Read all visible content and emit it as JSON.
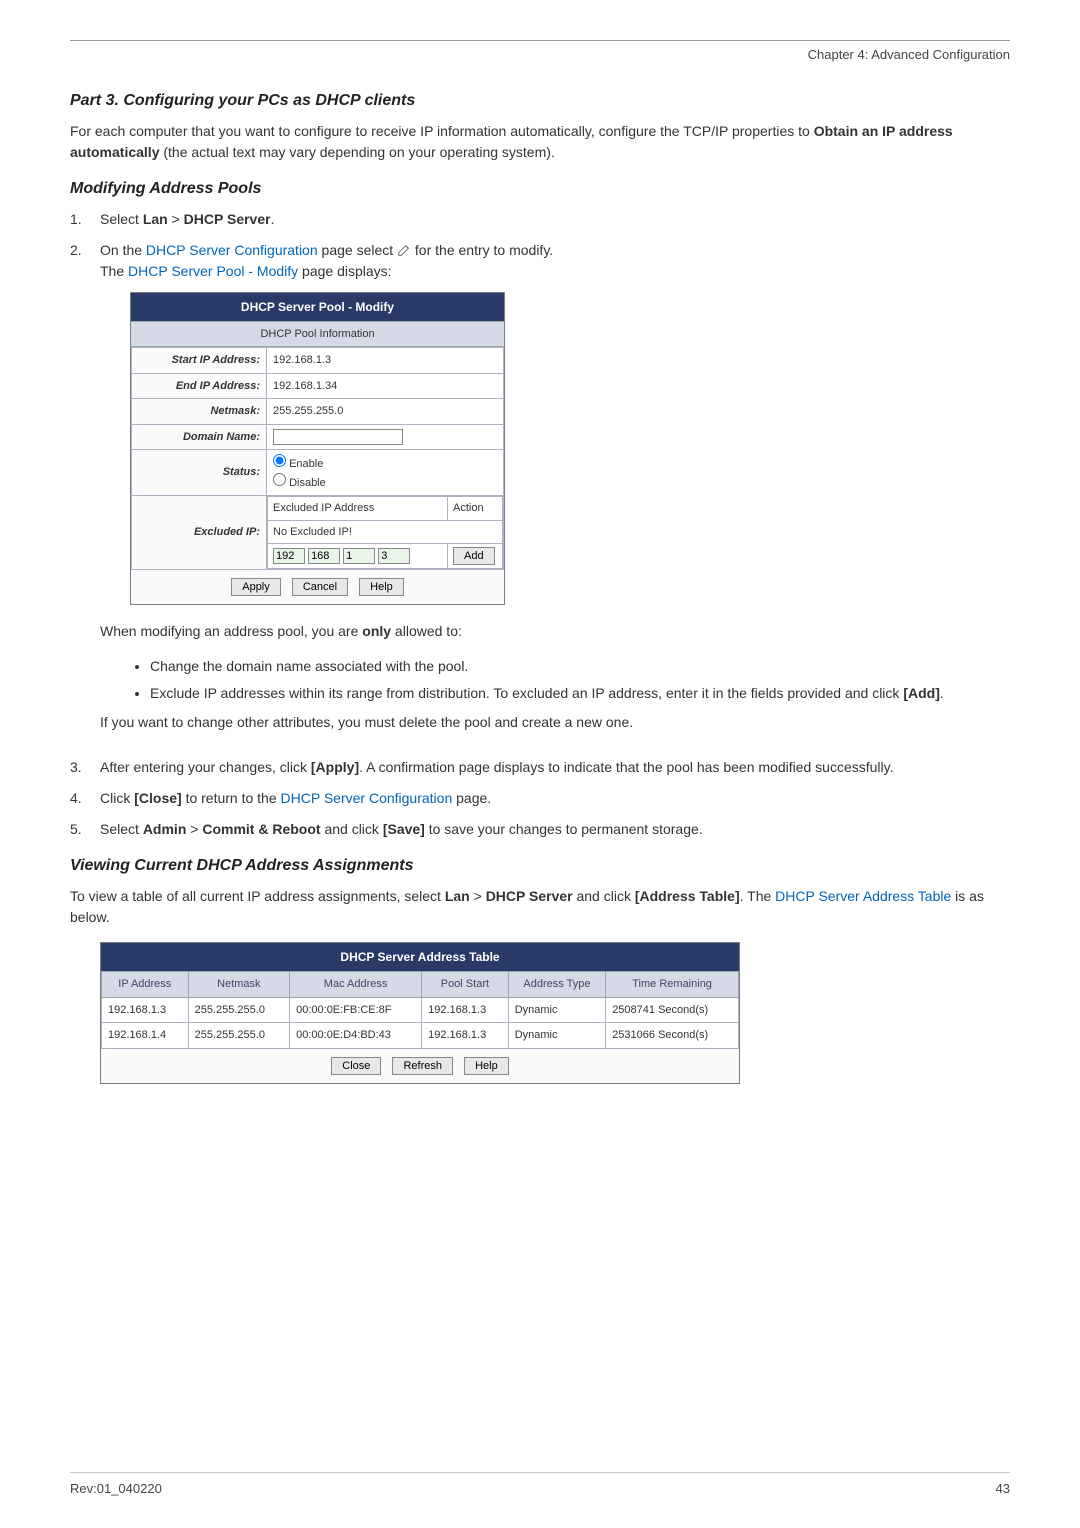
{
  "header": {
    "chapter": "Chapter 4: Advanced Configuration"
  },
  "part3": {
    "title": "Part 3. Configuring your PCs as DHCP clients",
    "intro_a": "For each computer that you want to configure to receive IP information automatically, configure the TCP/IP properties to ",
    "intro_bold": "Obtain an IP address automatically",
    "intro_b": " (the actual text may vary depending on your operating system)."
  },
  "modify": {
    "title": "Modifying Address Pools",
    "step1_a": "Select ",
    "step1_lan": "Lan",
    "step1_gt": " > ",
    "step1_dhcp": "DHCP Server",
    "step1_end": ".",
    "step2_a": "On the ",
    "step2_link": "DHCP Server Configuration",
    "step2_b": " page select ",
    "step2_c": " for the entry to modify.",
    "step2_d": "The ",
    "step2_link2": "DHCP Server Pool - Modify",
    "step2_e": " page displays:"
  },
  "modify_panel": {
    "title": "DHCP Server Pool - Modify",
    "subheader": "DHCP Pool Information",
    "rows": {
      "start_ip_label": "Start IP Address:",
      "start_ip_val": "192.168.1.3",
      "end_ip_label": "End IP Address:",
      "end_ip_val": "192.168.1.34",
      "netmask_label": "Netmask:",
      "netmask_val": "255.255.255.0",
      "domain_label": "Domain Name:",
      "status_label": "Status:",
      "status_enable": "Enable",
      "status_disable": "Disable",
      "excluded_label": "Excluded IP:",
      "excluded_col1": "Excluded IP Address",
      "excluded_col2": "Action",
      "excluded_none": "No Excluded IP!",
      "oct1": "192",
      "oct2": "168",
      "oct3": "1",
      "oct4": "3",
      "add_btn": "Add"
    },
    "buttons": {
      "apply": "Apply",
      "cancel": "Cancel",
      "help": "Help"
    }
  },
  "modify_notes": {
    "intro_a": "When modifying an address pool, you are ",
    "intro_bold": "only",
    "intro_b": " allowed to:",
    "bullet1": "Change the domain name associated with the pool.",
    "bullet2_a": "Exclude IP addresses within its range from distribution. To excluded an IP address, enter it in the fields provided and click ",
    "bullet2_bold": "[Add]",
    "bullet2_b": ".",
    "after": "If you want to change other attributes, you must delete the pool and create a new one."
  },
  "step3": {
    "a": "After entering your changes, click ",
    "bold": "[Apply]",
    "b": ". A confirmation page displays to indicate that the pool has been modified successfully."
  },
  "step4": {
    "a": "Click ",
    "bold": "[Close]",
    "b": " to return to the ",
    "link": "DHCP Server Configuration",
    "c": " page."
  },
  "step5": {
    "a": "Select ",
    "bold1": "Admin",
    "gt": " > ",
    "bold2": "Commit & Reboot",
    "b": " and click ",
    "bold3": "[Save]",
    "c": " to save your changes to permanent storage."
  },
  "viewing": {
    "title": "Viewing Current DHCP Address Assignments",
    "intro_a": "To view a table of all current IP address assignments, select ",
    "bold1": "Lan",
    "gt": " > ",
    "bold2": "DHCP Server",
    "b": " and click ",
    "bold3": "[Address Table]",
    "c": ". The ",
    "link": "DHCP Server Address Table",
    "d": " is as below."
  },
  "addr_panel": {
    "title": "DHCP Server Address Table",
    "headers": {
      "ip": "IP Address",
      "netmask": "Netmask",
      "mac": "Mac Address",
      "pool": "Pool Start",
      "type": "Address Type",
      "time": "Time Remaining"
    },
    "rows": [
      {
        "ip": "192.168.1.3",
        "netmask": "255.255.255.0",
        "mac": "00:00:0E:FB:CE:8F",
        "pool": "192.168.1.3",
        "type": "Dynamic",
        "time": "2508741 Second(s)"
      },
      {
        "ip": "192.168.1.4",
        "netmask": "255.255.255.0",
        "mac": "00:00:0E:D4:BD:43",
        "pool": "192.168.1.3",
        "type": "Dynamic",
        "time": "2531066 Second(s)"
      }
    ],
    "buttons": {
      "close": "Close",
      "refresh": "Refresh",
      "help": "Help"
    }
  },
  "footer": {
    "left": "Rev:01_040220",
    "right": "43"
  }
}
